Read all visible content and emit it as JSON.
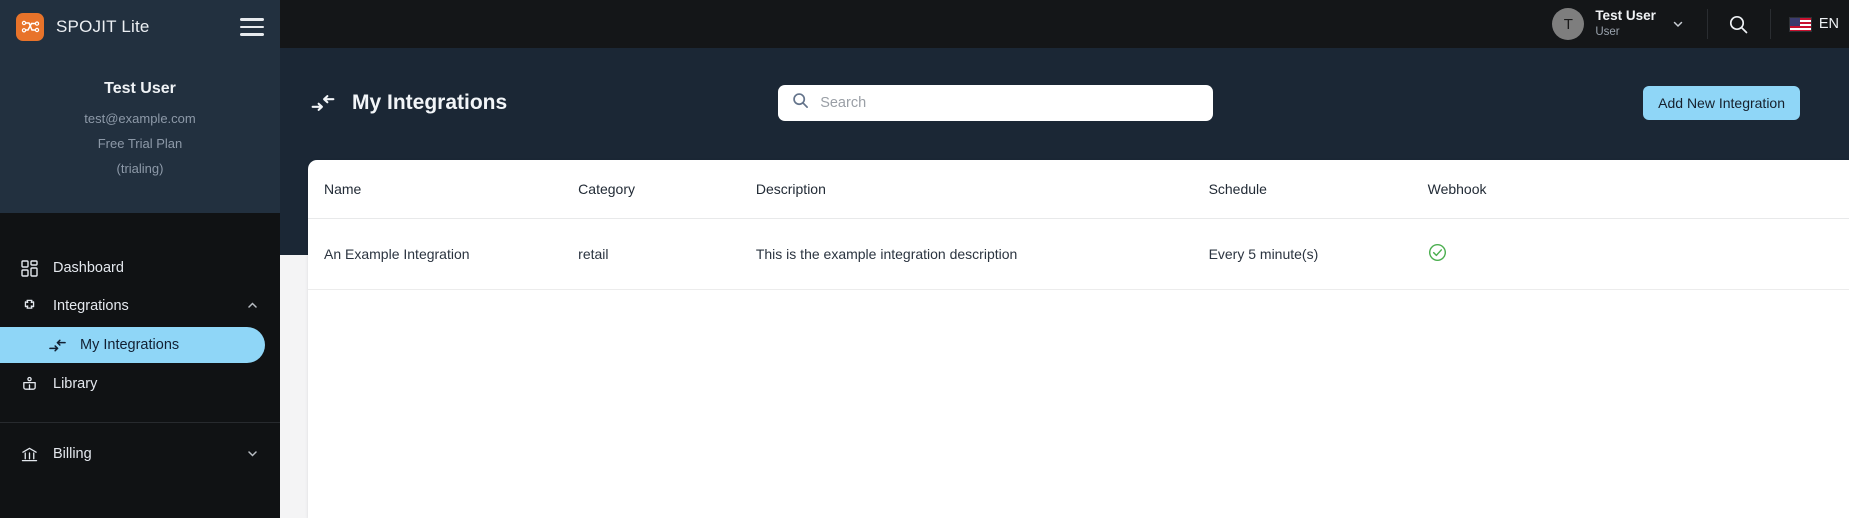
{
  "brand": {
    "name": "SPOJIT Lite",
    "logo_icon": "spojit-graph-logo",
    "menu_icon": "hamburger-icon"
  },
  "sidebar": {
    "user": {
      "name": "Test User",
      "email": "test@example.com",
      "plan": "Free Trial Plan",
      "status": "(trialing)"
    },
    "nav": [
      {
        "label": "Dashboard",
        "icon": "dashboard-grid-icon",
        "expandable": false
      },
      {
        "label": "Integrations",
        "icon": "puzzle-piece-icon",
        "expandable": true,
        "chevron": "chevron-up-icon"
      },
      {
        "label": "My Integrations",
        "icon": "integration-arrows-icon",
        "sub": true,
        "active": true
      },
      {
        "label": "Library",
        "icon": "library-book-icon",
        "expandable": false
      }
    ],
    "bottom_nav": [
      {
        "label": "Billing",
        "icon": "bank-icon",
        "expandable": true,
        "chevron": "chevron-down-icon"
      }
    ]
  },
  "topbar": {
    "avatar_initial": "T",
    "user_name": "Test User",
    "user_role": "User",
    "chevron_icon": "chevron-down-icon",
    "search_icon": "search-icon",
    "language": "EN",
    "flag_icon": "us-flag-icon"
  },
  "page": {
    "title": "My Integrations",
    "title_icon": "integration-arrows-icon",
    "search": {
      "placeholder": "Search",
      "value": "",
      "icon": "search-icon"
    },
    "add_button": "Add New Integration"
  },
  "table": {
    "columns": [
      "Name",
      "Category",
      "Description",
      "Schedule",
      "Webhook"
    ],
    "rows": [
      {
        "name": "An Example Integration",
        "category": "retail",
        "description": "This is the example integration description",
        "schedule": "Every 5 minute(s)",
        "webhook_status": "enabled",
        "webhook_icon": "check-circle-icon",
        "actions": [
          "edit-pencil-icon",
          "run-play-icon",
          "delete-trash-icon"
        ]
      }
    ]
  },
  "colors": {
    "accent_blue": "#8fd6f7",
    "brand_orange": "#e8732a",
    "hero_navy": "#1b2735",
    "sidebar_dark": "#101214",
    "success_green": "#4caf50",
    "danger_red": "#e03c31",
    "edit_blue": "#4a90e2"
  }
}
